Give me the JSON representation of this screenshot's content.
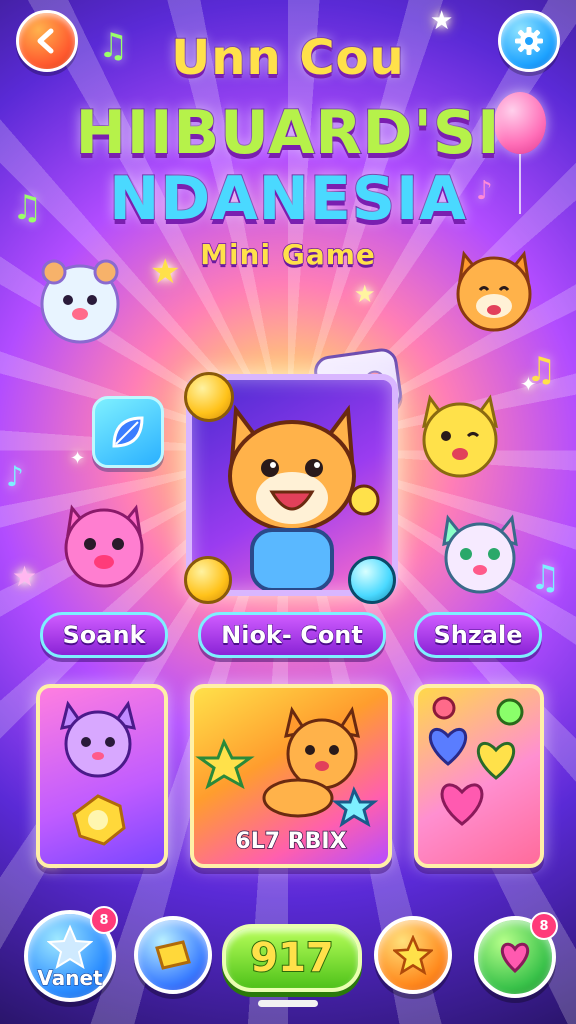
{
  "header": {
    "back_icon": "back-arrow-icon",
    "settings_icon": "gear-icon"
  },
  "title": {
    "line1": "Unn Cou",
    "line2": "HIIBUARD'SI",
    "line3": "NDANESIA",
    "subtitle": "Mini Game"
  },
  "characters": {
    "pill_left": "Soank",
    "pill_center": "Niok- Cont",
    "pill_right": "Shzale"
  },
  "cards": {
    "middle_label": "6L7 RBIX"
  },
  "bottom_bar": {
    "favorites_label": "Vanet",
    "favorites_badge": "8",
    "play_value": "917",
    "heart_badge": "8"
  },
  "colors": {
    "accent_yellow": "#ffe14a",
    "accent_purple": "#8a23d6",
    "accent_green": "#4fc21a",
    "accent_cyan": "#4ad9ff"
  }
}
